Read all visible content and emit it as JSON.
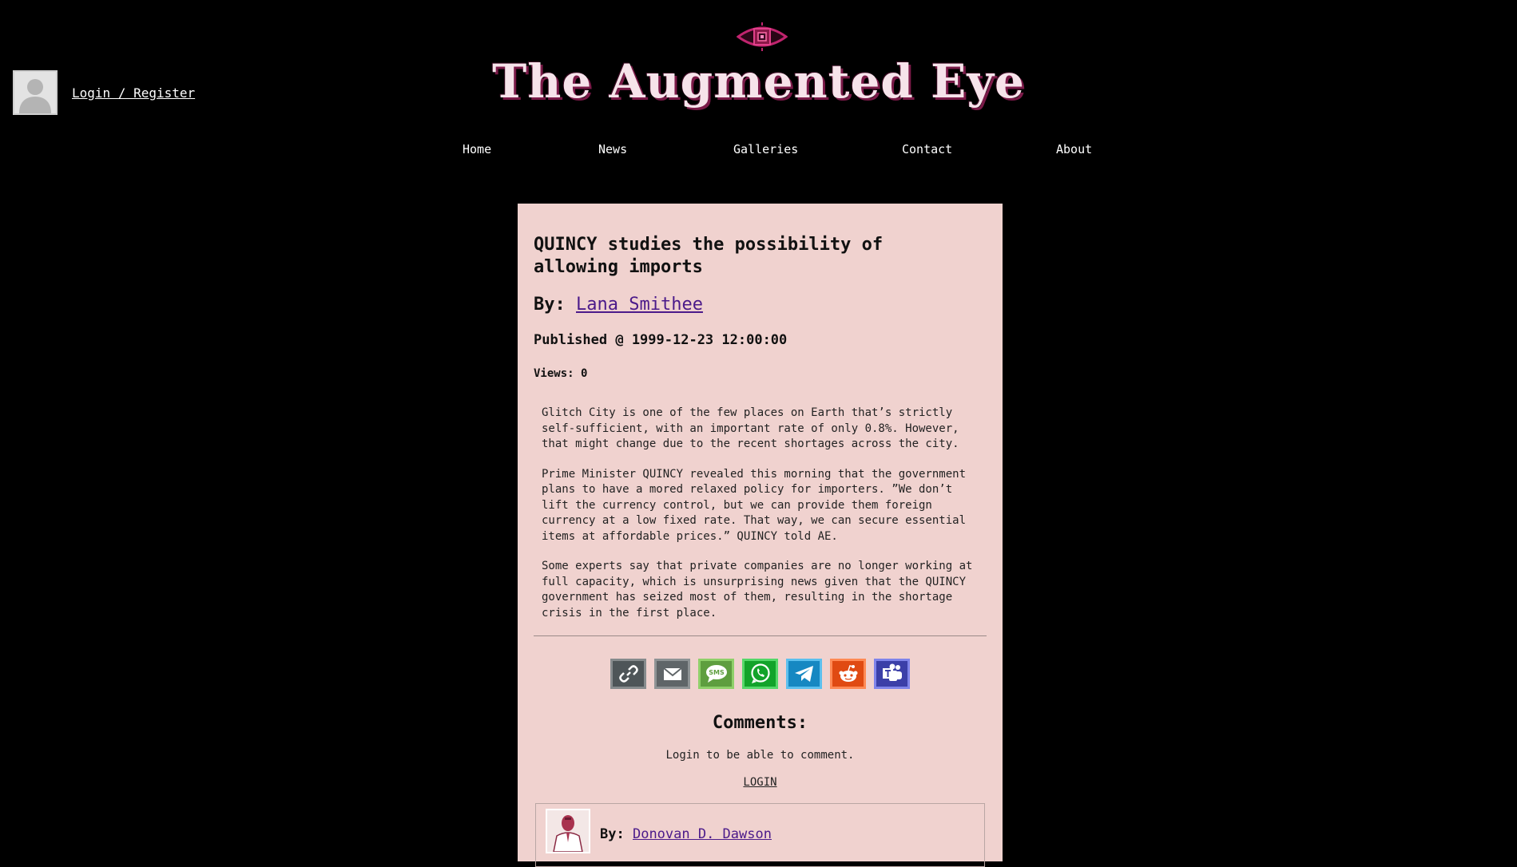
{
  "user": {
    "login_label": "Login / Register"
  },
  "site": {
    "title": "The Augmented Eye"
  },
  "nav": {
    "items": [
      "Home",
      "News",
      "Galleries",
      "Contact",
      "About"
    ]
  },
  "article": {
    "title": "QUINCY studies the possibility of allowing imports",
    "by_prefix": "By:",
    "author": "Lana Smithee",
    "published": "Published @ 1999-12-23 12:00:00",
    "views": "Views: 0",
    "paragraphs": [
      "Glitch City is one of the few places on Earth that’s strictly self-sufficient, with an important rate of only 0.8%. However, that might change due to the recent shortages across the city.",
      "Prime Minister QUINCY revealed this morning that the government plans to have a mored relaxed policy for importers. ”We don’t lift the currency control, but we can provide them foreign currency at a low fixed rate. That way, we can secure essential items at affordable prices.” QUINCY told AE.",
      "Some experts say that private companies are no longer working at full capacity, which is unsurprising news given that the QUINCY government has seized most of them, resulting in the shortage crisis in the first place."
    ]
  },
  "share": {
    "buttons": [
      {
        "name": "copy-link",
        "icon": "link-icon",
        "bg": "#4e5558",
        "border": "#868b8d"
      },
      {
        "name": "email",
        "icon": "envelope-icon",
        "bg": "#5f6568",
        "border": "#8e9395"
      },
      {
        "name": "sms",
        "icon": "sms-icon",
        "bg": "#5e9e3f",
        "border": "#8fd06a"
      },
      {
        "name": "whatsapp",
        "icon": "whatsapp-icon",
        "bg": "#12a32a",
        "border": "#55d86a"
      },
      {
        "name": "telegram",
        "icon": "telegram-icon",
        "bg": "#1688c2",
        "border": "#5cc0ee"
      },
      {
        "name": "reddit",
        "icon": "reddit-icon",
        "bg": "#e04a12",
        "border": "#ff8a55"
      },
      {
        "name": "teams",
        "icon": "teams-icon",
        "bg": "#3b3fa8",
        "border": "#7f84ea"
      }
    ],
    "sms_text": "SMS"
  },
  "comments": {
    "heading": "Comments:",
    "login_message": "Login to be able to comment.",
    "login_button": "LOGIN",
    "items": [
      {
        "by_prefix": "By:",
        "author": "Donovan D. Dawson"
      }
    ]
  }
}
